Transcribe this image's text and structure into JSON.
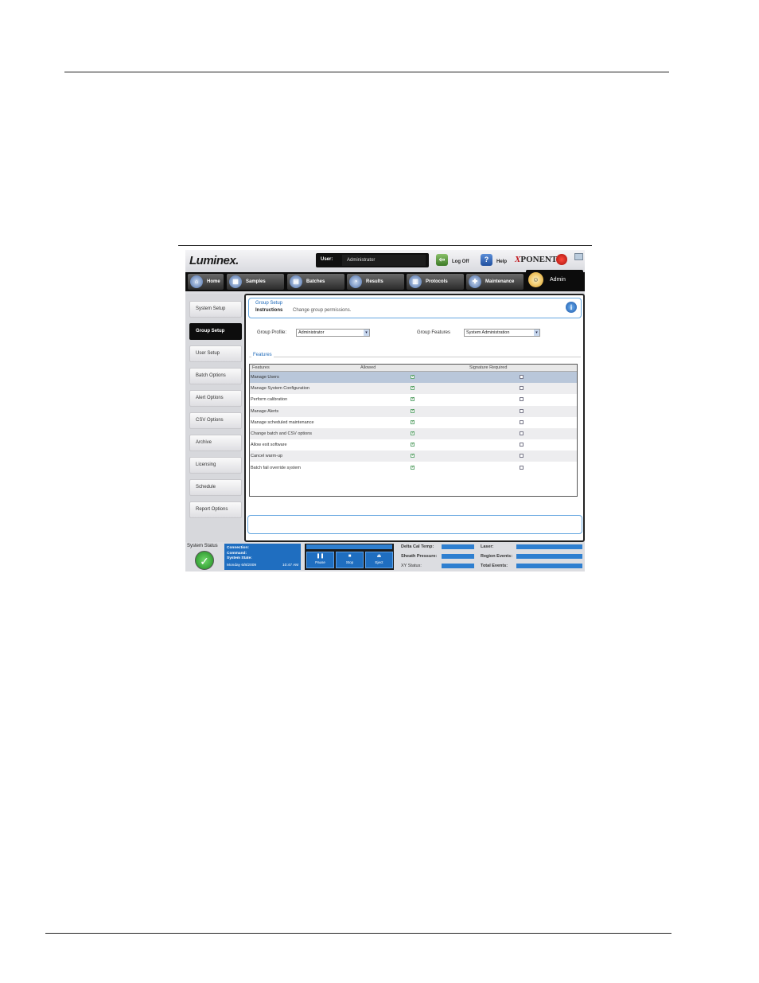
{
  "app": {
    "logo": "Luminex.",
    "brand": "XPONENT",
    "brand_x": "X",
    "brand_rest": "PONENT"
  },
  "header": {
    "user_label": "User:",
    "user_value": "Administrator",
    "logoff_label": "Log Off",
    "help_label": "Help"
  },
  "nav": {
    "tabs": [
      {
        "label": "Home"
      },
      {
        "label": "Samples"
      },
      {
        "label": "Batches"
      },
      {
        "label": "Results"
      },
      {
        "label": "Protocols"
      },
      {
        "label": "Maintenance"
      },
      {
        "label": "Admin"
      }
    ]
  },
  "sidebar": {
    "items": [
      {
        "label": "System Setup"
      },
      {
        "label": "Group Setup"
      },
      {
        "label": "User Setup"
      },
      {
        "label": "Batch Options"
      },
      {
        "label": "Alert Options"
      },
      {
        "label": "CSV Options"
      },
      {
        "label": "Archive"
      },
      {
        "label": "Licensing"
      },
      {
        "label": "Schedule"
      },
      {
        "label": "Report Options"
      }
    ]
  },
  "main": {
    "title": "Group Setup",
    "instructions_label": "Instructions",
    "instructions_text": "Change group permissions.",
    "info_icon": "i",
    "group_profile_label": "Group Profile:",
    "group_profile_value": "Administrator",
    "group_features_label": "Group Features",
    "group_features_value": "System Administration",
    "features_legend": "Features",
    "columns": [
      "Features",
      "Allowed",
      "Signature Required"
    ],
    "rows": [
      {
        "feature": "Manage Users",
        "allowed": true,
        "signature": false
      },
      {
        "feature": "Manage System Configuration",
        "allowed": true,
        "signature": false
      },
      {
        "feature": "Perform calibration",
        "allowed": true,
        "signature": false
      },
      {
        "feature": "Manage Alerts",
        "allowed": true,
        "signature": false
      },
      {
        "feature": "Manage scheduled maintenance",
        "allowed": true,
        "signature": false
      },
      {
        "feature": "Change batch and CSV options",
        "allowed": true,
        "signature": false
      },
      {
        "feature": "Allow exit software",
        "allowed": true,
        "signature": false
      },
      {
        "feature": "Cancel warm-up",
        "allowed": true,
        "signature": false
      },
      {
        "feature": "Batch fail override system",
        "allowed": true,
        "signature": false
      }
    ]
  },
  "status": {
    "label": "System Status",
    "connection_label": "Connection:",
    "command_label": "Command:",
    "system_state_label": "System State:",
    "date": "Monday 6/8/2009",
    "time": "10:47 AM",
    "pause_label": "Pause",
    "stop_label": "Stop",
    "eject_label": "Eject",
    "delta_cal_temp_label": "Delta Cal Temp:",
    "sheath_pressure_label": "Sheath Pressure:",
    "xy_status_label": "XY Status:",
    "laser_label": "Laser:",
    "region_events_label": "Region Events:",
    "total_events_label": "Total Events:"
  },
  "colors": {
    "accent": "#1d69b9",
    "status_blue": "#1f6ec0",
    "selected_row": "#b9c7da",
    "nav_bg": "#0c0c0c"
  }
}
